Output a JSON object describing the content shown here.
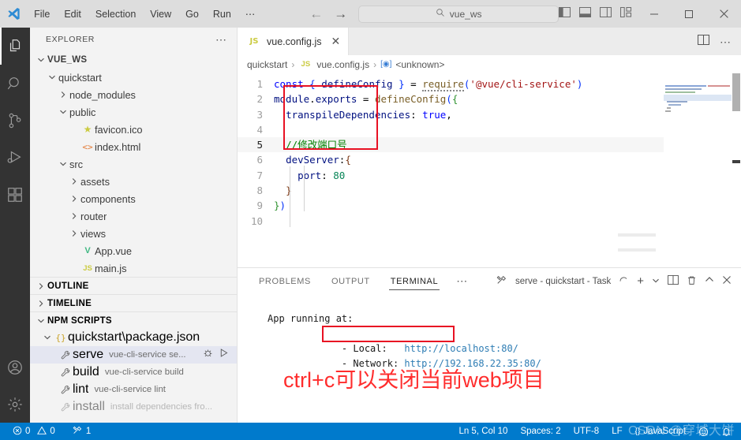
{
  "titlebar": {
    "menu": [
      "File",
      "Edit",
      "Selection",
      "View",
      "Go",
      "Run",
      "⋯"
    ],
    "quick_open_value": "vue_ws",
    "nav_back": "←",
    "nav_forward": "→",
    "minimize": "—",
    "maximize": "☐",
    "close": "✕"
  },
  "activitybar": {
    "items": [
      {
        "name": "explorer",
        "icon": "files-icon",
        "active": true
      },
      {
        "name": "search",
        "icon": "search-icon",
        "active": false
      },
      {
        "name": "source-control",
        "icon": "source-control-icon",
        "active": false
      },
      {
        "name": "run-and-debug",
        "icon": "run-debug-icon",
        "active": false
      },
      {
        "name": "extensions",
        "icon": "extensions-icon",
        "active": false
      },
      {
        "name": "accounts",
        "icon": "account-icon",
        "active": false
      },
      {
        "name": "settings",
        "icon": "gear-icon",
        "active": false
      }
    ]
  },
  "sidebar": {
    "title": "EXPLORER",
    "more_actions": "⋯",
    "root": "VUE_WS",
    "tree": [
      {
        "label": "quickstart",
        "indent": 1,
        "twisty": "open",
        "icon": "none"
      },
      {
        "label": "node_modules",
        "indent": 2,
        "twisty": "closed",
        "icon": "none"
      },
      {
        "label": "public",
        "indent": 2,
        "twisty": "open",
        "icon": "none"
      },
      {
        "label": "favicon.ico",
        "indent": 3,
        "twisty": "none",
        "icon": "star-icon"
      },
      {
        "label": "index.html",
        "indent": 3,
        "twisty": "none",
        "icon": "html-icon"
      },
      {
        "label": "src",
        "indent": 2,
        "twisty": "open",
        "icon": "none"
      },
      {
        "label": "assets",
        "indent": 3,
        "twisty": "closed",
        "icon": "none"
      },
      {
        "label": "components",
        "indent": 3,
        "twisty": "closed",
        "icon": "none"
      },
      {
        "label": "router",
        "indent": 3,
        "twisty": "closed",
        "icon": "none"
      },
      {
        "label": "views",
        "indent": 3,
        "twisty": "closed",
        "icon": "none"
      },
      {
        "label": "App.vue",
        "indent": 3,
        "twisty": "none",
        "icon": "vue-icon"
      },
      {
        "label": "main.js",
        "indent": 3,
        "twisty": "none",
        "icon": "js-icon"
      }
    ],
    "sections": [
      {
        "label": "OUTLINE",
        "state": "closed"
      },
      {
        "label": "TIMELINE",
        "state": "closed"
      },
      {
        "label": "NPM SCRIPTS",
        "state": "open"
      }
    ],
    "npm": {
      "file": "quickstart\\package.json",
      "scripts": [
        {
          "name": "serve",
          "command": "vue-cli-service se...",
          "selected": true,
          "dim": false
        },
        {
          "name": "build",
          "command": "vue-cli-service build",
          "selected": false,
          "dim": false
        },
        {
          "name": "lint",
          "command": "vue-cli-service lint",
          "selected": false,
          "dim": false
        },
        {
          "name": "install",
          "command": "install dependencies fro...",
          "selected": false,
          "dim": true
        }
      ],
      "debug_label": "debug-icon",
      "run_label": "run-icon"
    }
  },
  "editor": {
    "tab": {
      "label": "vue.config.js",
      "icon": "js-icon",
      "close": "✕"
    },
    "tab_actions": [
      "split-editor-icon",
      "more-actions-icon"
    ],
    "breadcrumb": [
      "quickstart",
      "vue.config.js",
      "<unknown>"
    ],
    "lines": [
      {
        "n": "1",
        "html": "<span class='kw'>const</span> <span class='brk1'>{</span> <span class='vr'>defineConfig</span> <span class='brk1'>}</span> <span class='op'>=</span> <span class='fn squig'>require</span><span class='brk1'>(</span><span class='str'>'@vue/cli-service'</span><span class='brk1'>)</span>",
        "current": false
      },
      {
        "n": "2",
        "html": "<span class='vr'>module</span>.<span class='vr'>exports</span> <span class='op'>=</span> <span class='fn'>defineConfig</span><span class='brk1'>(</span><span class='brk2'>{</span>",
        "current": false
      },
      {
        "n": "3",
        "html": "  <span class='vr'>transpileDependencies</span>: <span class='kw'>true</span>,",
        "current": false
      },
      {
        "n": "4",
        "html": "",
        "current": false
      },
      {
        "n": "5",
        "html": "  <span class='cm'>//修改端口号</span>",
        "current": true
      },
      {
        "n": "6",
        "html": "  <span class='vr'>devServer</span>:<span class='brk3'>{</span>",
        "current": false
      },
      {
        "n": "7",
        "html": "    <span class='vr'>port</span>: <span class='num'>80</span>",
        "current": false
      },
      {
        "n": "8",
        "html": "  <span class='brk3'>}</span>",
        "current": false
      },
      {
        "n": "9",
        "html": "<span class='brk2'>}</span><span class='brk1'>)</span>",
        "current": false
      },
      {
        "n": "10",
        "html": "",
        "current": false
      }
    ],
    "highlight_note": "red-rectangle-around-devserver-block"
  },
  "panel": {
    "tabs": [
      {
        "label": "PROBLEMS",
        "active": false
      },
      {
        "label": "OUTPUT",
        "active": false
      },
      {
        "label": "TERMINAL",
        "active": true
      }
    ],
    "more": "⋯",
    "active_terminal": "serve - quickstart - Task",
    "terminal_icon": "tools-icon",
    "spinner_icon": "loading-spinner-icon",
    "actions": [
      "new-terminal-icon",
      "terminal-dropdown-icon",
      "split-terminal-icon",
      "kill-terminal-icon",
      "maximize-panel-icon",
      "close-panel-icon"
    ],
    "terminal_lines": [
      {
        "text": "App running at:",
        "kind": "plain"
      },
      {
        "text": " - Local:   http://localhost:80/",
        "kind": "local"
      },
      {
        "text": " - Network: http://192.168.22.35:80/",
        "kind": "network"
      }
    ],
    "local_url": "http://localhost:80/",
    "network_url": "http://192.168.22.35:80/",
    "annotation": "ctrl+c可以关闭当前web项目",
    "annotation_color": "#ff2d2d"
  },
  "statusbar": {
    "errors": "0",
    "warnings": "0",
    "ports": "1",
    "cursor": "Ln 5, Col 10",
    "indentation": "Spaces: 2",
    "encoding": "UTF-8",
    "eol": "LF",
    "language": "JavaScript",
    "feedback_icon": "bell-icon",
    "smiley_icon": "smiley-icon",
    "background": "#007acc",
    "watermark": "CSDN @穿城大饼"
  }
}
